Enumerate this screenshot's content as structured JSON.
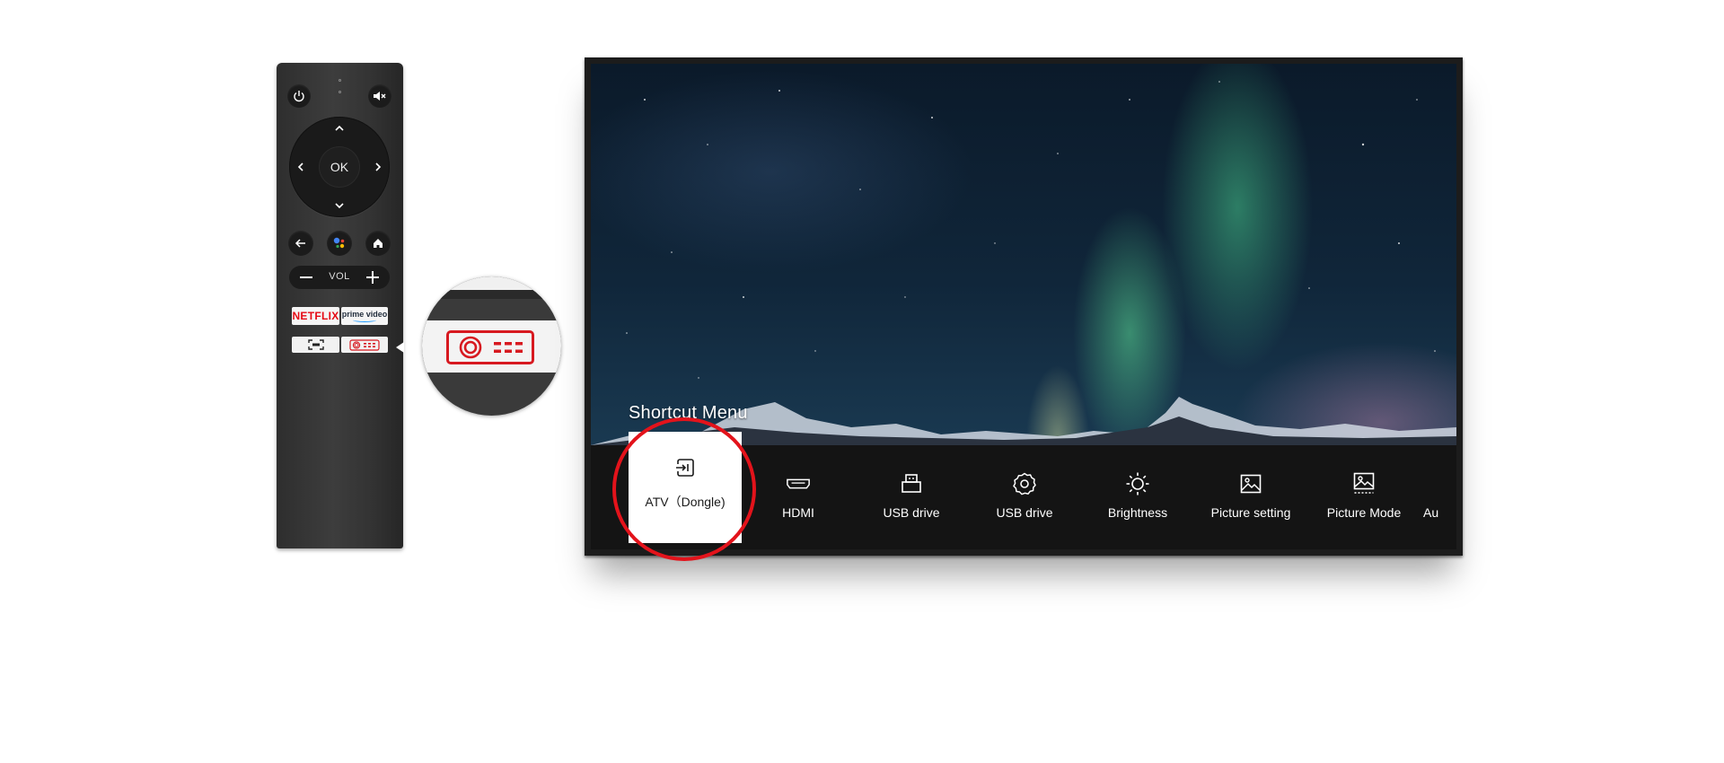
{
  "remote": {
    "ok_label": "OK",
    "vol_label": "VOL",
    "netflix_label": "NETFLIX",
    "prime_label": "prime video"
  },
  "tv": {
    "menu_title": "Shortcut Menu",
    "menu_items": [
      {
        "label": "ATV（Dongle)",
        "icon": "input-source-icon",
        "selected": true
      },
      {
        "label": "HDMI",
        "icon": "hdmi-icon"
      },
      {
        "label": "USB drive",
        "icon": "usb-drive-icon"
      },
      {
        "label": "USB drive",
        "icon": "settings-gear-icon"
      },
      {
        "label": "Brightness",
        "icon": "brightness-sun-icon"
      },
      {
        "label": "Picture setting",
        "icon": "picture-icon"
      },
      {
        "label": "Picture Mode",
        "icon": "picture-mode-icon"
      },
      {
        "label": "Au",
        "icon": "audio-icon"
      }
    ]
  },
  "colors": {
    "accent_red": "#e3131b",
    "menu_bar": "#141414",
    "selected_tile": "#ffffff"
  }
}
